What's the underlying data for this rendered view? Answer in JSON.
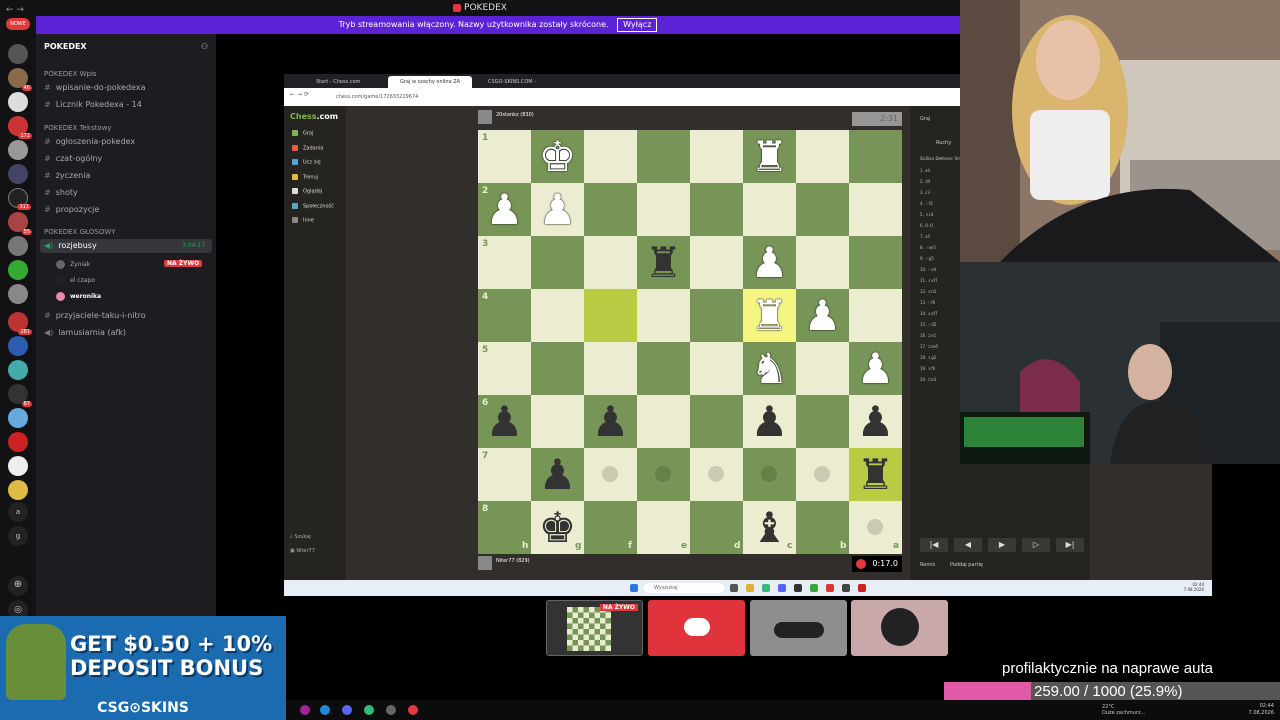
{
  "title_bar": {
    "title": "POKEDEX",
    "nav": "← →"
  },
  "notice": {
    "text": "Tryb streamowania włączony. Nazwy użytkownika zostały skrócone.",
    "button": "Wyłącz"
  },
  "servers": {
    "new_badge": "NOWE",
    "badges": [
      "46",
      "172",
      "311",
      "55",
      "281",
      "87"
    ],
    "letters": [
      "a",
      "g"
    ]
  },
  "sidebar": {
    "guild": "POKEDEX",
    "categories": [
      "POKEDEX Wpis",
      "POKEDEX Tekstowy",
      "POKEDEX GŁOSOWY"
    ],
    "channels_wpis": [
      "wpisanie-do-pokedexa",
      "Licznik Pokedexa - 14"
    ],
    "channels_text": [
      "ogłoszenia-pokedex",
      "czat-ogólny",
      "życzenia",
      "shoty",
      "propozycje"
    ],
    "voice_channel": "rozjebusy",
    "voice_timer": "3:04:17",
    "voice_users": [
      "Zyniak",
      "el czapo",
      "weronika"
    ],
    "live_badge": "NA ŻYWO",
    "channels_more": [
      "przyjaciele-taku-i-nitro",
      "lamusiarnia (afk)"
    ]
  },
  "browser": {
    "tabs": [
      "Start - Chess.com",
      "Graj w szachy online ZA DARMO",
      "CSGO-SKINS.COM - Najlepszy"
    ],
    "url": "chess.com/game/172633229674"
  },
  "chess": {
    "logo_a": "Chess",
    "logo_b": ".com",
    "nav": [
      "Graj",
      "Zadania",
      "Ucz się",
      "Trenuj",
      "Oglądaj",
      "Społeczność",
      "Inne"
    ],
    "bottom": [
      "Szukaj",
      "Niter77"
    ],
    "top_player": "20stankz (830)",
    "bottom_player": "Niter77 (829)",
    "top_clock": "2:31",
    "bottom_clock": "0:17.0",
    "ranks": [
      "1",
      "2",
      "3",
      "4",
      "5",
      "6",
      "7",
      "8"
    ],
    "files": [
      "h",
      "g",
      "f",
      "e",
      "d",
      "c",
      "b",
      "a"
    ],
    "right_header": [
      "Graj",
      "Ruchy",
      "Sicilian Defense: Smith-Morra"
    ],
    "moves": [
      "1. e4",
      "2. d4",
      "3. c3",
      "4. ♘f3",
      "5. ♗c4",
      "6. O-O",
      "7. e5",
      "8. ♘xe5",
      "9. ♘g5",
      "10. ♘e4",
      "11. ♗xf7",
      "12. ♕h5",
      "13. ♘f6",
      "14. ♕xf7",
      "15. ♘d5",
      "16. ♖e1",
      "17. ♖xe5",
      "18. ♗g5",
      "19. ♗f6",
      "20. ♖e3"
    ],
    "controls": [
      "|◀",
      "◀",
      "▶",
      "▷",
      "▶|"
    ],
    "footer": [
      "Remis",
      "Poddaj partię"
    ]
  },
  "taskbar": {
    "search": "Wyszukaj",
    "time": "02:44",
    "date": "7.08.2026"
  },
  "ad": {
    "line1": "GET $0.50 + 10%",
    "line2": "DEPOSIT BONUS",
    "brand": "CSG⊙SKINS"
  },
  "preview_live": "NA ŻYWO",
  "goal": {
    "title": "profilaktycznie na naprawe auta",
    "label": "259.00 / 1000 (25.9%)",
    "fraction": 0.259
  },
  "win_task": {
    "weather": "Duże zachmurz...",
    "temp": "22°C",
    "time": "02:44",
    "date": "7.08.2026"
  },
  "colors": {
    "accent": "#5c23d6",
    "live": "#e03a3e",
    "light_sq": "#ebecd0",
    "dark_sq": "#779556",
    "goal": "#e05aa8"
  }
}
